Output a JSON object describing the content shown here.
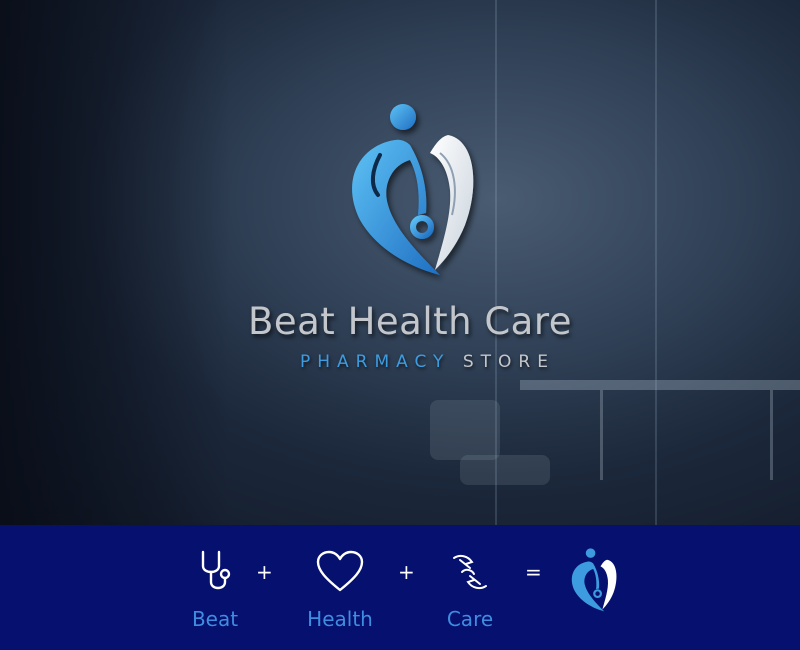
{
  "brand": {
    "name": "Beat Health Care",
    "tagline_part1": "PHARMACY",
    "tagline_part2": "STORE"
  },
  "equation": {
    "items": [
      {
        "icon": "stethoscope-icon",
        "label": "Beat"
      },
      {
        "icon": "heart-icon",
        "label": "Health"
      },
      {
        "icon": "caring-hands-icon",
        "label": "Care"
      }
    ],
    "plus": "+",
    "equals": "="
  },
  "colors": {
    "accent": "#3d9ce0",
    "band": "#06106e",
    "label": "#3f8de0"
  }
}
